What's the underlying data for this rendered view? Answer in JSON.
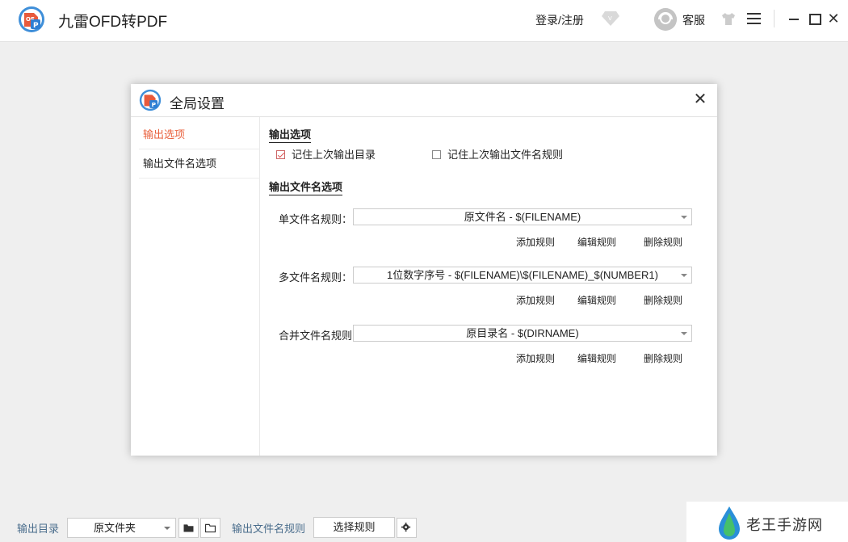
{
  "app": {
    "title": "九雷OFD转PDF",
    "login_label": "登录/注册",
    "service_label": "客服"
  },
  "dialog": {
    "title": "全局设置",
    "sidebar": [
      {
        "label": "输出选项",
        "active": true
      },
      {
        "label": "输出文件名选项",
        "active": false
      }
    ],
    "output_options": {
      "title": "输出选项",
      "remember_dir_label": "记住上次输出目录",
      "remember_dir_checked": true,
      "remember_rule_label": "记住上次输出文件名规则",
      "remember_rule_checked": false
    },
    "filename_options": {
      "title": "输出文件名选项",
      "rules": [
        {
          "label": "单文件名规则：",
          "value": "原文件名 - $(FILENAME)"
        },
        {
          "label": "多文件名规则：",
          "value": "1位数字序号 - $(FILENAME)\\$(FILENAME)_$(NUMBER1)"
        },
        {
          "label": "合并文件名规则：",
          "value": "原目录名 - $(DIRNAME)"
        }
      ],
      "add_label": "添加规则",
      "edit_label": "编辑规则",
      "delete_label": "删除规则"
    }
  },
  "bottombar": {
    "output_dir_label": "输出目录",
    "output_dir_value": "原文件夹",
    "filename_rule_label": "输出文件名规则",
    "choose_rule_label": "选择规则"
  },
  "watermark": {
    "text": "老王手游网"
  },
  "colors": {
    "accent": "#e9603c",
    "bottom_label": "#4a6d8c",
    "background": "#efefef"
  }
}
